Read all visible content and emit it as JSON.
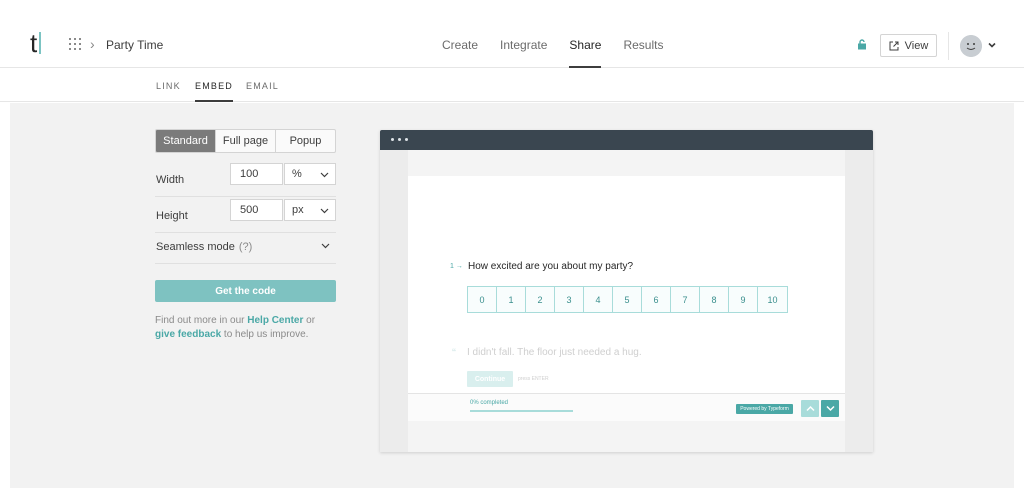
{
  "app": {
    "logo_letter": "t",
    "breadcrumb_title": "Party Time"
  },
  "nav": {
    "items": [
      "Create",
      "Integrate",
      "Share",
      "Results"
    ],
    "active": "Share"
  },
  "header": {
    "view_label": "View"
  },
  "subtabs": {
    "items": [
      "LINK",
      "EMBED",
      "EMAIL"
    ],
    "active": "EMBED"
  },
  "embed": {
    "modes": [
      "Standard",
      "Full page",
      "Popup"
    ],
    "active_mode": "Standard",
    "width_label": "Width",
    "width_value": "100",
    "width_unit": "%",
    "height_label": "Height",
    "height_value": "500",
    "height_unit": "px",
    "seamless_label": "Seamless mode",
    "seamless_hint": "(?)",
    "get_code_label": "Get the code",
    "help_prefix": "Find out more in our ",
    "help_center_link": "Help Center",
    "help_or": " or",
    "feedback_link": "give feedback",
    "help_suffix": " to help us improve."
  },
  "preview": {
    "question_number": "1 →",
    "question_text": "How excited are you about my party?",
    "scale": [
      "0",
      "1",
      "2",
      "3",
      "4",
      "5",
      "6",
      "7",
      "8",
      "9",
      "10"
    ],
    "next_quote": "“",
    "next_question_text": "I didn't fall. The floor just needed a hug.",
    "continue_label": "Continue",
    "press_enter": "press ENTER",
    "progress_label": "0% completed",
    "progress_value": 0,
    "powered_by": "Powered by Typeform"
  },
  "colors": {
    "accent": "#4aa8a6",
    "accent_light": "#7ec2c1",
    "window_bar": "#3a4650"
  }
}
